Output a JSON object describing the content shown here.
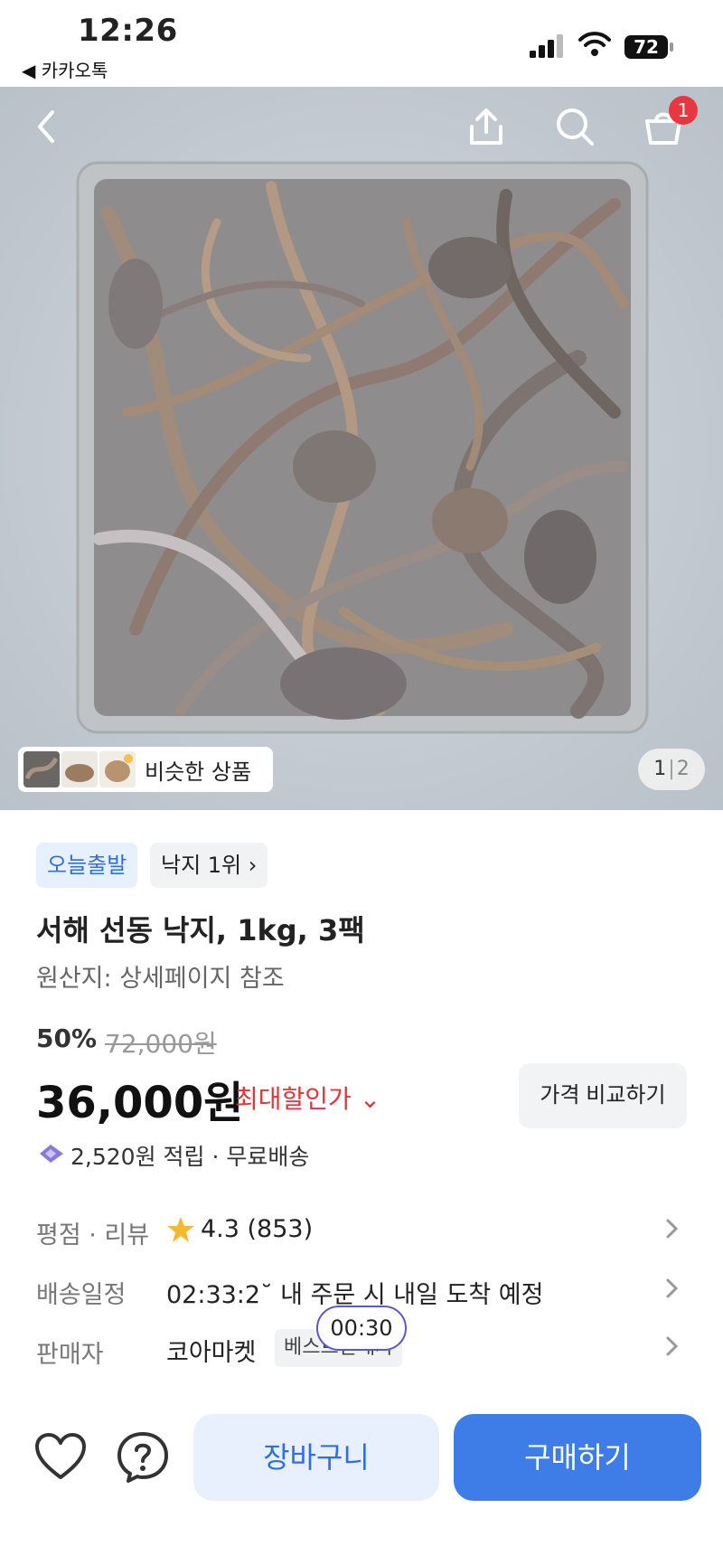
{
  "status_bar": {
    "time": "12:26",
    "back_app": "◀ 카카오톡",
    "battery": "72"
  },
  "header": {
    "icons": [
      "back-icon",
      "share-icon",
      "search-icon",
      "cart-icon"
    ],
    "cart_count": "1"
  },
  "gallery": {
    "similar_label": "비슷한 상품",
    "page_current": "1",
    "page_separator": "|",
    "page_total": "2"
  },
  "product": {
    "tags": [
      "오늘출발",
      "낙지 1위 ›"
    ],
    "title": "서해 선동 낙지, 1kg, 3팩",
    "origin": "원산지: 상세페이지 참조",
    "discount": "50%",
    "original_price": "72,000원",
    "price": "36,000원",
    "max_discount_label": "최대할인가 ⌄",
    "compare_button": "가격 비교하기",
    "points": "2,520원 적립 · 무료배송"
  },
  "info_rows": {
    "rating_label": "평점 · 리뷰",
    "rating_value": "4.3 (853)",
    "shipping_label": "배송일정",
    "shipping_value": "02:33:2˘ 내 주문 시 내일 도착 예정",
    "seller_label": "판매자",
    "seller_value": "코아마켓",
    "seller_badge": "베스트판매자",
    "timer_bubble": "00:30"
  },
  "bottom_bar": {
    "cart_button": "장바구니",
    "buy_button": "구매하기"
  },
  "colors": {
    "primary_blue": "#3e7de8",
    "light_blue": "#e8f0fd",
    "discount_red": "#e0353b",
    "badge_red": "#e9373f"
  }
}
